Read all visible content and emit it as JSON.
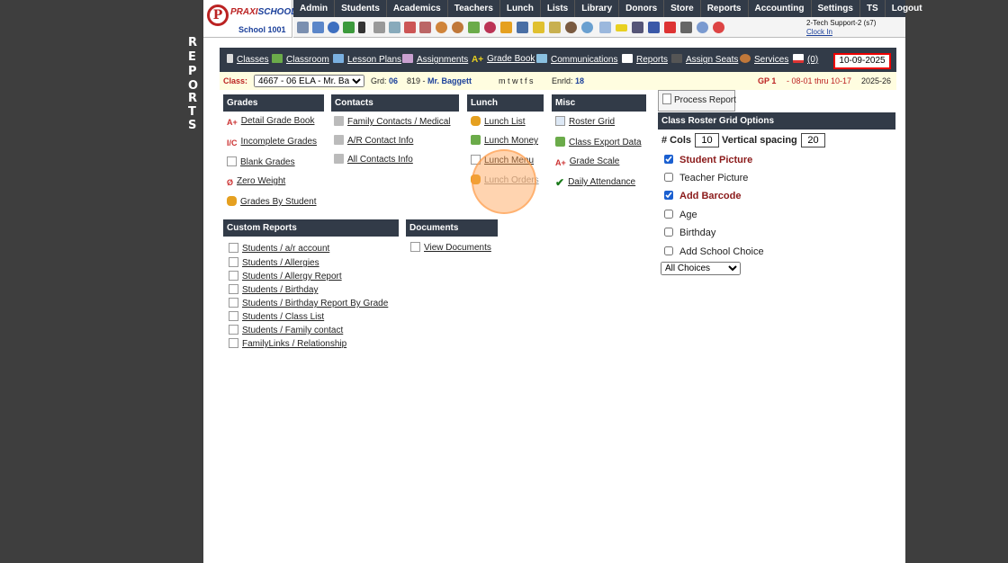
{
  "side_label": [
    "R",
    "E",
    "P",
    "O",
    "R",
    "T",
    "S"
  ],
  "logo": {
    "brand_left": "PRAXI",
    "brand_right": "SCHOOL",
    "school": "School 1001",
    "mark": "P"
  },
  "topnav": [
    "Admin",
    "Students",
    "Academics",
    "Teachers",
    "Lunch",
    "Lists",
    "Library",
    "Donors",
    "Store",
    "Reports",
    "Accounting",
    "Settings",
    "TS",
    "Logout"
  ],
  "user": {
    "name": "2-Tech Support-2 (s7)",
    "clock": "Clock In"
  },
  "toolbar": {
    "items": [
      "Classes",
      "Classroom",
      "Lesson Plans",
      "Assignments",
      "Grade Book",
      "Communications",
      "Reports",
      "Assign Seats",
      "Services",
      "(0)"
    ],
    "date": "10-09-2025"
  },
  "classbar": {
    "class_label": "Class:",
    "class_value": "4667 - 06 ELA - Mr. Baggett",
    "grd_label": "Grd:",
    "grd_value": "06",
    "room": "819 -",
    "teacher": "Mr. Baggett",
    "days": "m t w t f s",
    "enrld_label": "Enrld:",
    "enrld_value": "18",
    "gp": "GP 1",
    "range": "- 08-01 thru 10-17",
    "year": "2025-26"
  },
  "sections": {
    "grades": {
      "title": "Grades",
      "items": [
        "Detail Grade Book",
        "Incomplete Grades",
        "Blank Grades",
        "Zero Weight",
        "Grades By Student"
      ]
    },
    "contacts": {
      "title": "Contacts",
      "items": [
        "Family Contacts / Medical",
        "A/R Contact Info",
        "All Contacts Info"
      ]
    },
    "lunch": {
      "title": "Lunch",
      "items": [
        "Lunch List",
        "Lunch Money",
        "Lunch Menu",
        "Lunch Orders"
      ]
    },
    "misc": {
      "title": "Misc",
      "items": [
        "Roster Grid",
        "Class Export Data",
        "Grade Scale",
        "Daily Attendance"
      ]
    },
    "custom": {
      "title": "Custom Reports",
      "items": [
        "Students / a/r account",
        "Students / Allergies",
        "Students / Allergy Report",
        "Students / Birthday",
        "Students / Birthday Report By Grade",
        "Students / Class List",
        "Students / Family contact",
        "FamilyLinks / Relationship"
      ]
    },
    "documents": {
      "title": "Documents",
      "items": [
        "View Documents"
      ]
    }
  },
  "process_report": "Process Report",
  "options": {
    "title": "Class Roster Grid Options",
    "cols_label": "# Cols",
    "cols_value": "10",
    "spacing_label": "Vertical spacing",
    "spacing_value": "20",
    "checks": [
      {
        "label": "Student Picture",
        "checked": true
      },
      {
        "label": "Teacher Picture",
        "checked": false
      },
      {
        "label": "Add Barcode",
        "checked": true
      },
      {
        "label": "Age",
        "checked": false
      },
      {
        "label": "Birthday",
        "checked": false
      },
      {
        "label": "Add School Choice",
        "checked": false
      }
    ],
    "choice_select": "All Choices"
  },
  "colors": {
    "nav": "#323b48",
    "accent_red": "#b22222",
    "link_blue": "#1a3f9a"
  }
}
